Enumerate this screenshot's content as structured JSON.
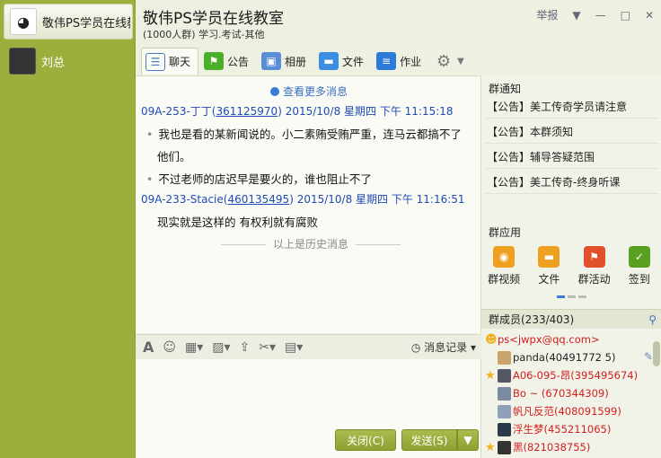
{
  "sidebar": {
    "items": [
      {
        "label": "敬伟PS学员在线教室"
      },
      {
        "label": "刘总"
      }
    ]
  },
  "header": {
    "title": "敬伟PS学员在线教室",
    "subtitle": "(1000人群) 学习.考试-其他",
    "report": "举报"
  },
  "tabs": [
    {
      "label": "聊天",
      "icon": "chat-icon"
    },
    {
      "label": "公告",
      "icon": "announcement-icon"
    },
    {
      "label": "相册",
      "icon": "album-icon"
    },
    {
      "label": "文件",
      "icon": "folder-icon"
    },
    {
      "label": "作业",
      "icon": "homework-icon"
    }
  ],
  "chat": {
    "more_link": "查看更多消息",
    "messages": [
      {
        "sender": "09A-253-丁丁",
        "qq": "361125970",
        "time": "2015/10/8 星期四 下午 11:15:18",
        "lines": [
          "我也是看的某新闻说的。小二素贿受贿严重，连马云都搞不了",
          "他们。",
          "不过老师的店迟早是要火的，谁也阻止不了"
        ]
      },
      {
        "sender": "09A-233-Stacie",
        "qq": "460135495",
        "time": "2015/10/8 星期四 下午 11:16:51",
        "lines": [
          "现实就是这样的 有权利就有腐败"
        ]
      }
    ],
    "history_divider": "以上是历史消息"
  },
  "input": {
    "history_button": "消息记录",
    "close_button": "关闭(C)",
    "send_button": "发送(S)"
  },
  "notices": {
    "title": "群通知",
    "items": [
      "【公告】美工传奇学员请注意",
      "【公告】本群须知",
      "【公告】辅导答疑范围",
      "【公告】美工传奇-终身听课"
    ]
  },
  "apps": {
    "title": "群应用",
    "items": [
      {
        "label": "群视频",
        "color": "#f0a020"
      },
      {
        "label": "文件",
        "color": "#f0a020"
      },
      {
        "label": "群活动",
        "color": "#e0502a"
      },
      {
        "label": "签到",
        "color": "#5aa020"
      }
    ]
  },
  "members": {
    "title": "群成员(233/403)",
    "items": [
      {
        "name": "ps<jwpx@qq.com>",
        "color": "#d21e1e",
        "star": false
      },
      {
        "name": "panda(40491772 5)",
        "color": "#222",
        "star": false
      },
      {
        "name": "A06-095-昂(395495674)",
        "color": "#d21e1e",
        "star": true
      },
      {
        "name": "Bo ~  (670344309)",
        "color": "#d21e1e",
        "star": false
      },
      {
        "name": "帆凡反范(408091599)",
        "color": "#d21e1e",
        "star": false
      },
      {
        "name": "浮生梦(455211065)",
        "color": "#d21e1e",
        "star": false
      },
      {
        "name": "黑(821038755)",
        "color": "#d21e1e",
        "star": true
      }
    ]
  }
}
